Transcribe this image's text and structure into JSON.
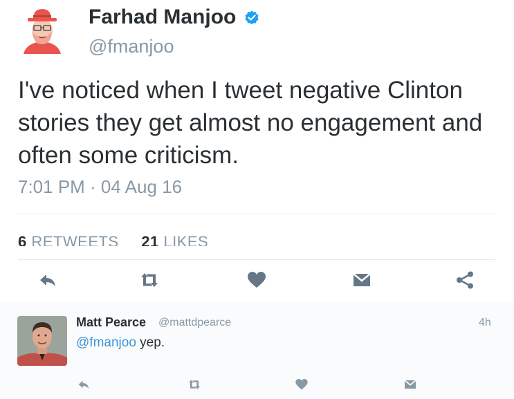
{
  "tweet": {
    "author_name": "Farhad Manjoo",
    "author_handle": "@fmanjoo",
    "text": "I've noticed when I tweet negative Clinton\nstories they get almost no engagement and\noften some criticism.",
    "timestamp": "7:01 PM · 04 Aug 16",
    "stats": {
      "retweets_count": "6",
      "retweets_label": "RETWEETS",
      "likes_count": "21",
      "likes_label": "LIKES"
    },
    "actions": [
      "reply-icon",
      "retweet-icon",
      "heart-icon",
      "envelope-icon",
      "share-icon"
    ]
  },
  "reply": {
    "author_name": "Matt Pearce",
    "author_handle": "@mattdpearce",
    "time": "4h",
    "mention": "@fmanjoo",
    "text": " yep.",
    "actions": [
      "reply-icon",
      "retweet-icon",
      "heart-icon",
      "envelope-icon"
    ]
  },
  "colors": {
    "text": "#292f33",
    "muted": "#8899a6",
    "link": "#3b94d9",
    "verified": "#1da1f2",
    "icon": "#657786",
    "divider": "#e1e8ed"
  }
}
